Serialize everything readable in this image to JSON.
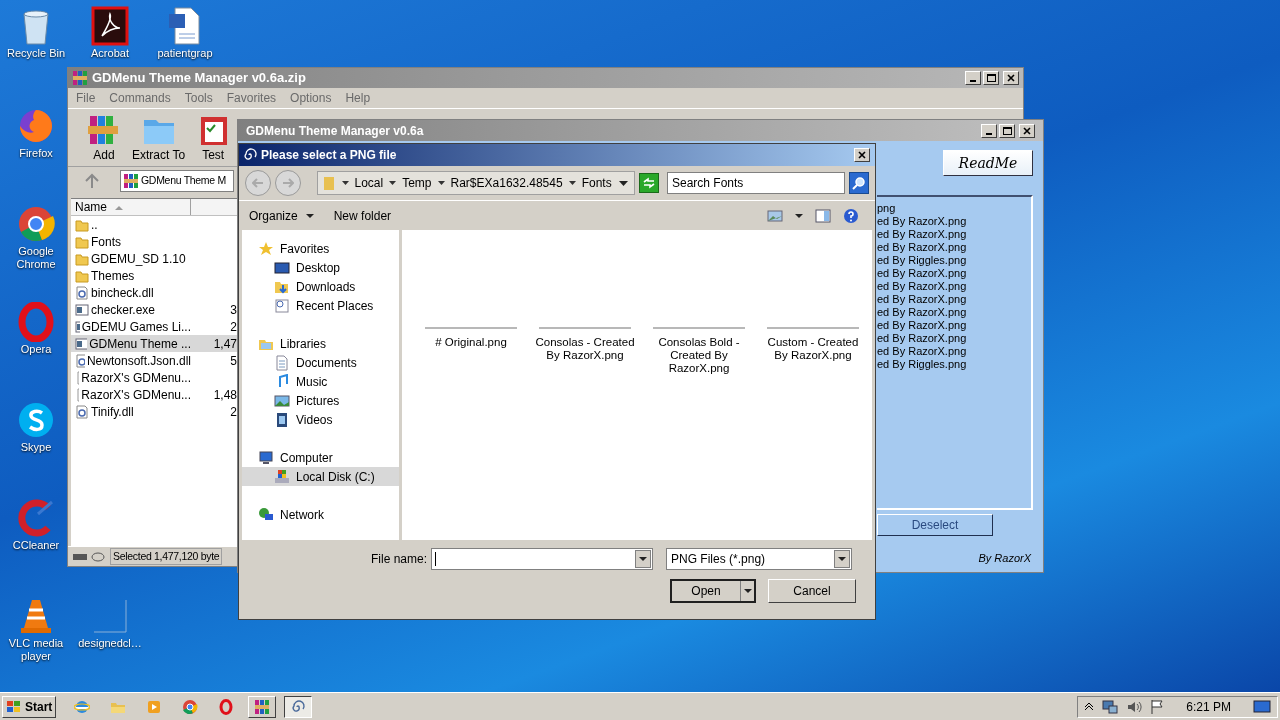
{
  "desktop_icons": [
    {
      "label": "Recycle Bin"
    },
    {
      "label": "Acrobat"
    },
    {
      "label": "patientgrap"
    },
    {
      "label": "Firefox"
    },
    {
      "label": "Google Chrome"
    },
    {
      "label": "Opera"
    },
    {
      "label": "Skype"
    },
    {
      "label": "CCleaner"
    },
    {
      "label": "VLC media player"
    },
    {
      "label": "designedcl…"
    }
  ],
  "archive_window": {
    "title": "GDMenu Theme Manager v0.6a.zip",
    "menu": [
      "File",
      "Commands",
      "Tools",
      "Favorites",
      "Options",
      "Help"
    ],
    "toolbar": [
      "Add",
      "Extract To",
      "Test"
    ],
    "address": "GDMenu Theme M",
    "columns": [
      "Name"
    ],
    "rows": [
      {
        "name": "..",
        "kind": "folder",
        "selected": false
      },
      {
        "name": "Fonts",
        "kind": "folder",
        "selected": false
      },
      {
        "name": "GDEMU_SD 1.10",
        "kind": "folder",
        "selected": false
      },
      {
        "name": "Themes",
        "kind": "folder",
        "selected": false
      },
      {
        "name": "bincheck.dll",
        "kind": "dll",
        "selected": false
      },
      {
        "name": "checker.exe",
        "size": "3",
        "kind": "exe",
        "selected": false
      },
      {
        "name": "GDEMU Games Li...",
        "size": "2",
        "kind": "exe",
        "selected": false
      },
      {
        "name": "GDMenu Theme ...",
        "size": "1,47",
        "kind": "exe",
        "selected": true
      },
      {
        "name": "Newtonsoft.Json.dll",
        "size": "5",
        "kind": "dll",
        "selected": false
      },
      {
        "name": "RazorX's GDMenu...",
        "kind": "file",
        "selected": false
      },
      {
        "name": "RazorX's GDMenu...",
        "size": "1,48",
        "kind": "file",
        "selected": false
      },
      {
        "name": "Tinify.dll",
        "size": "2",
        "kind": "dll",
        "selected": false
      }
    ],
    "status": "Selected 1,477,120 byte"
  },
  "theme_manager_window": {
    "title": "GDMenu Theme Manager v0.6a",
    "readme_button": "ReadMe",
    "list": [
      "png",
      "ed By RazorX.png",
      "ed By RazorX.png",
      "ed By RazorX.png",
      "ed By Riggles.png",
      "ed By RazorX.png",
      "ed By RazorX.png",
      "ed By RazorX.png",
      "ed By RazorX.png",
      "ed By RazorX.png",
      "ed By RazorX.png",
      "ed By RazorX.png",
      "ed By Riggles.png"
    ],
    "deselect_button": "Deselect",
    "credit": "By RazorX"
  },
  "file_dialog": {
    "title": "Please select a PNG file",
    "breadcrumb": [
      "Local",
      "Temp",
      "Rar$EXa1632.48545",
      "Fonts"
    ],
    "search": {
      "placeholder": "Search Fonts"
    },
    "toolbar": [
      "Organize",
      "New folder"
    ],
    "nav": [
      {
        "label": "Favorites",
        "selected": false,
        "children": [
          {
            "label": "Desktop",
            "selected": false
          },
          {
            "label": "Downloads",
            "selected": false
          },
          {
            "label": "Recent Places",
            "selected": false
          }
        ]
      },
      {
        "label": "Libraries",
        "selected": false,
        "children": [
          {
            "label": "Documents",
            "selected": false
          },
          {
            "label": "Music",
            "selected": false
          },
          {
            "label": "Pictures",
            "selected": false
          },
          {
            "label": "Videos",
            "selected": false
          }
        ]
      },
      {
        "label": "Computer",
        "selected": false,
        "children": [
          {
            "label": "Local Disk (C:)",
            "selected": true
          }
        ]
      },
      {
        "label": "Network",
        "selected": false
      }
    ],
    "files": [
      "# Original.png",
      "Consolas - Created By RazorX.png",
      "Consolas Bold - Created By RazorX.png",
      "Custom - Created By RazorX.png"
    ],
    "file_name_label": "File name:",
    "file_type": "PNG Files (*.png)",
    "buttons": [
      "Open",
      "Cancel"
    ]
  },
  "taskbar": {
    "start": "Start",
    "apps": [
      {
        "kind": "pinned",
        "selected": false
      },
      {
        "kind": "pinned",
        "selected": false
      },
      {
        "kind": "pinned",
        "selected": false
      },
      {
        "kind": "pinned",
        "selected": false
      },
      {
        "kind": "pinned",
        "selected": false
      },
      {
        "kind": "window",
        "selected": false
      },
      {
        "kind": "window",
        "selected": true
      }
    ],
    "clock": "6:21 PM"
  }
}
